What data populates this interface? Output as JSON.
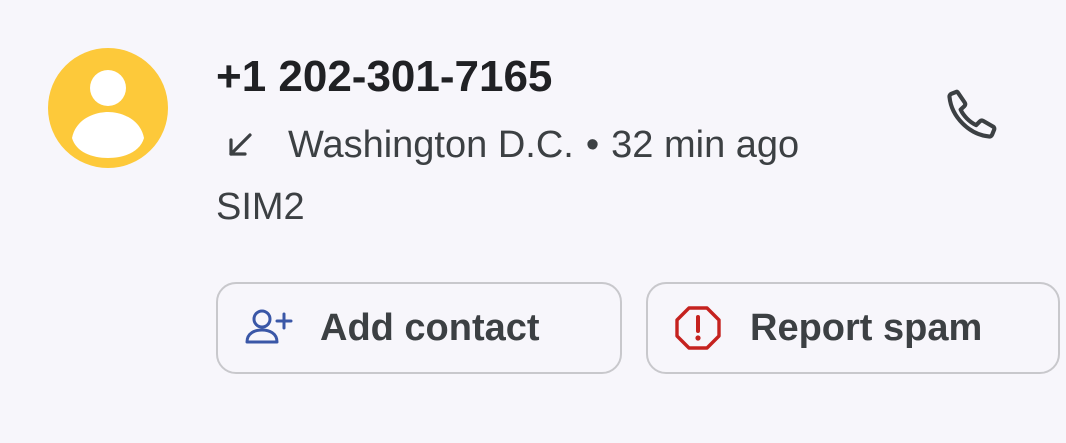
{
  "call_log_entry": {
    "phone_number": "+1 202-301-7165",
    "call_direction_icon": "incoming-call-arrow-icon",
    "location": "Washington D.C.",
    "separator": "•",
    "time_ago": "32 min ago",
    "sim": "SIM2",
    "avatar_icon": "person-icon",
    "call_icon": "phone-icon"
  },
  "actions": {
    "add_contact_label": "Add contact",
    "add_contact_icon": "add-person-icon",
    "report_spam_label": "Report spam",
    "report_spam_icon": "spam-warning-icon"
  },
  "colors": {
    "avatar_bg": "#fdc93a",
    "spam_icon": "#c5221f",
    "add_contact_icon": "#3a57a7",
    "background": "#f7f6fb"
  }
}
